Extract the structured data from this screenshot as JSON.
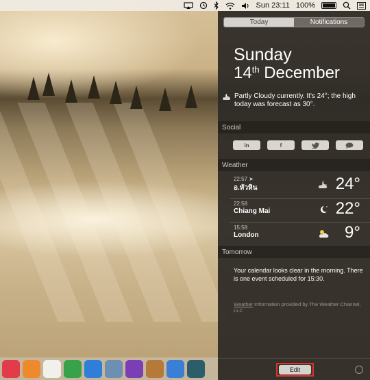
{
  "menubar": {
    "time": "Sun 23:11",
    "battery": "100%",
    "icons": [
      "airplay-icon",
      "time-machine-icon",
      "bluetooth-icon",
      "wifi-icon",
      "volume-icon",
      "battery-icon",
      "spotlight-icon",
      "notification-center-icon"
    ]
  },
  "tabs": {
    "today": "Today",
    "notifications": "Notifications"
  },
  "date": {
    "day": "Sunday",
    "date_num": "14",
    "ordinal": "th",
    "month": "December"
  },
  "forecast": "Partly Cloudy currently. It's 24°; the high today was forecast as 30°.",
  "social": {
    "header": "Social",
    "buttons": [
      "linkedin",
      "facebook",
      "twitter",
      "messages"
    ]
  },
  "weather": {
    "header": "Weather",
    "rows": [
      {
        "time": "22:57",
        "city": "อ.หัวหิน",
        "temp": "24°",
        "icon": "partly-cloudy-night-icon",
        "location_arrow": true
      },
      {
        "time": "22:58",
        "city": "Chiang Mai",
        "temp": "22°",
        "icon": "moon-icon"
      },
      {
        "time": "15:58",
        "city": "London",
        "temp": "9°",
        "icon": "partly-sunny-icon"
      }
    ]
  },
  "tomorrow": {
    "header": "Tomorrow",
    "text": "Your calendar looks clear in the morning. There is one event scheduled for 15:30."
  },
  "credit": {
    "link": "Weather",
    "rest": " information provided by The Weather Channel, LLC"
  },
  "footer": {
    "edit_label": "Edit"
  },
  "dock": {
    "apps": [
      {
        "name": "itunes-icon",
        "color": "#e23b4a"
      },
      {
        "name": "ibooks-icon",
        "color": "#ef8a2c"
      },
      {
        "name": "pages-icon",
        "color": "#f2f0ea"
      },
      {
        "name": "numbers-icon",
        "color": "#3aa14b"
      },
      {
        "name": "keynote-icon",
        "color": "#2f7fd8"
      },
      {
        "name": "preview-icon",
        "color": "#6c8fb3"
      },
      {
        "name": "imovie-icon",
        "color": "#7b3fb5"
      },
      {
        "name": "garageband-icon",
        "color": "#b57a3a"
      },
      {
        "name": "xcode-icon",
        "color": "#3a7fd3"
      },
      {
        "name": "time-machine-icon",
        "color": "#2c5d6b"
      }
    ]
  }
}
